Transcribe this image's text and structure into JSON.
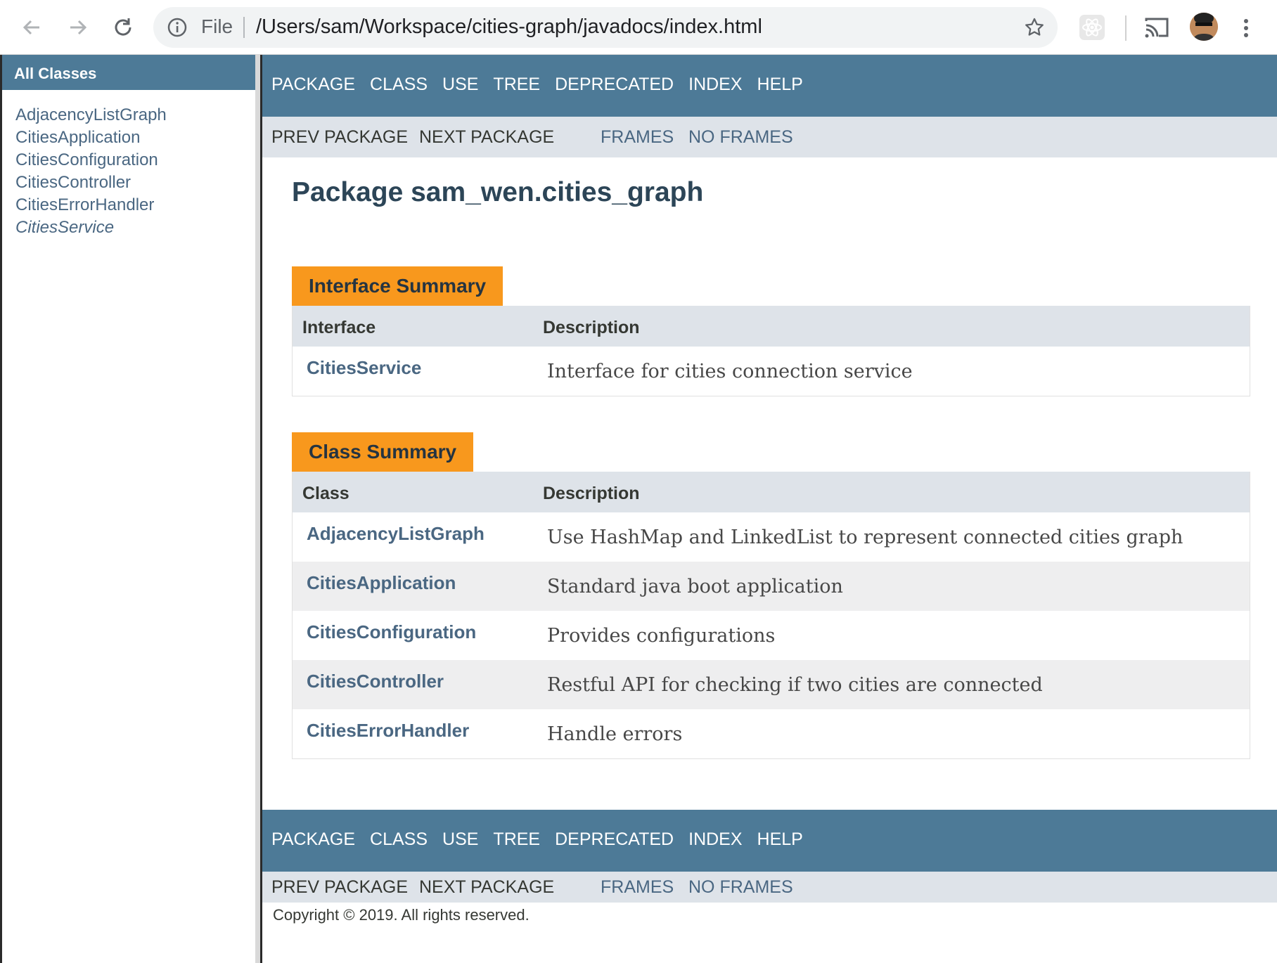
{
  "browser": {
    "omnibox_scheme": "File",
    "url": "/Users/sam/Workspace/cities-graph/javadocs/index.html",
    "icons": [
      "back-arrow-icon",
      "forward-arrow-icon",
      "reload-icon",
      "info-icon",
      "bookmark-star-icon",
      "react-devtools-icon",
      "cast-icon",
      "profile-avatar",
      "more-menu-icon"
    ]
  },
  "left_frame": {
    "title": "All Classes",
    "classes": [
      {
        "name": "AdjacencyListGraph",
        "italic": false
      },
      {
        "name": "CitiesApplication",
        "italic": false
      },
      {
        "name": "CitiesConfiguration",
        "italic": false
      },
      {
        "name": "CitiesController",
        "italic": false
      },
      {
        "name": "CitiesErrorHandler",
        "italic": false
      },
      {
        "name": "CitiesService",
        "italic": true
      }
    ]
  },
  "nav": {
    "links": [
      "PACKAGE",
      "CLASS",
      "USE",
      "TREE",
      "DEPRECATED",
      "INDEX",
      "HELP"
    ],
    "prev_package": "PREV PACKAGE",
    "next_package": "NEXT PACKAGE",
    "frames": "FRAMES",
    "no_frames": "NO FRAMES"
  },
  "package_title": "Package sam_wen.cities_graph",
  "interface_summary": {
    "caption": "Interface Summary",
    "col1": "Interface",
    "col2": "Description",
    "rows": [
      {
        "name": "CitiesService",
        "desc": "Interface for cities connection service"
      }
    ]
  },
  "class_summary": {
    "caption": "Class Summary",
    "col1": "Class",
    "col2": "Description",
    "rows": [
      {
        "name": "AdjacencyListGraph",
        "desc": "Use HashMap and LinkedList to represent connected cities graph"
      },
      {
        "name": "CitiesApplication",
        "desc": "Standard java boot application"
      },
      {
        "name": "CitiesConfiguration",
        "desc": "Provides configurations"
      },
      {
        "name": "CitiesController",
        "desc": "Restful API for checking if two cities are connected"
      },
      {
        "name": "CitiesErrorHandler",
        "desc": "Handle errors"
      }
    ]
  },
  "footer": {
    "copyright": "Copyright © 2019. All rights reserved."
  },
  "colors": {
    "nav_bar": "#4d7a97",
    "sub_nav": "#dee3e9",
    "caption_orange": "#f8981d",
    "link": "#4a6782"
  }
}
